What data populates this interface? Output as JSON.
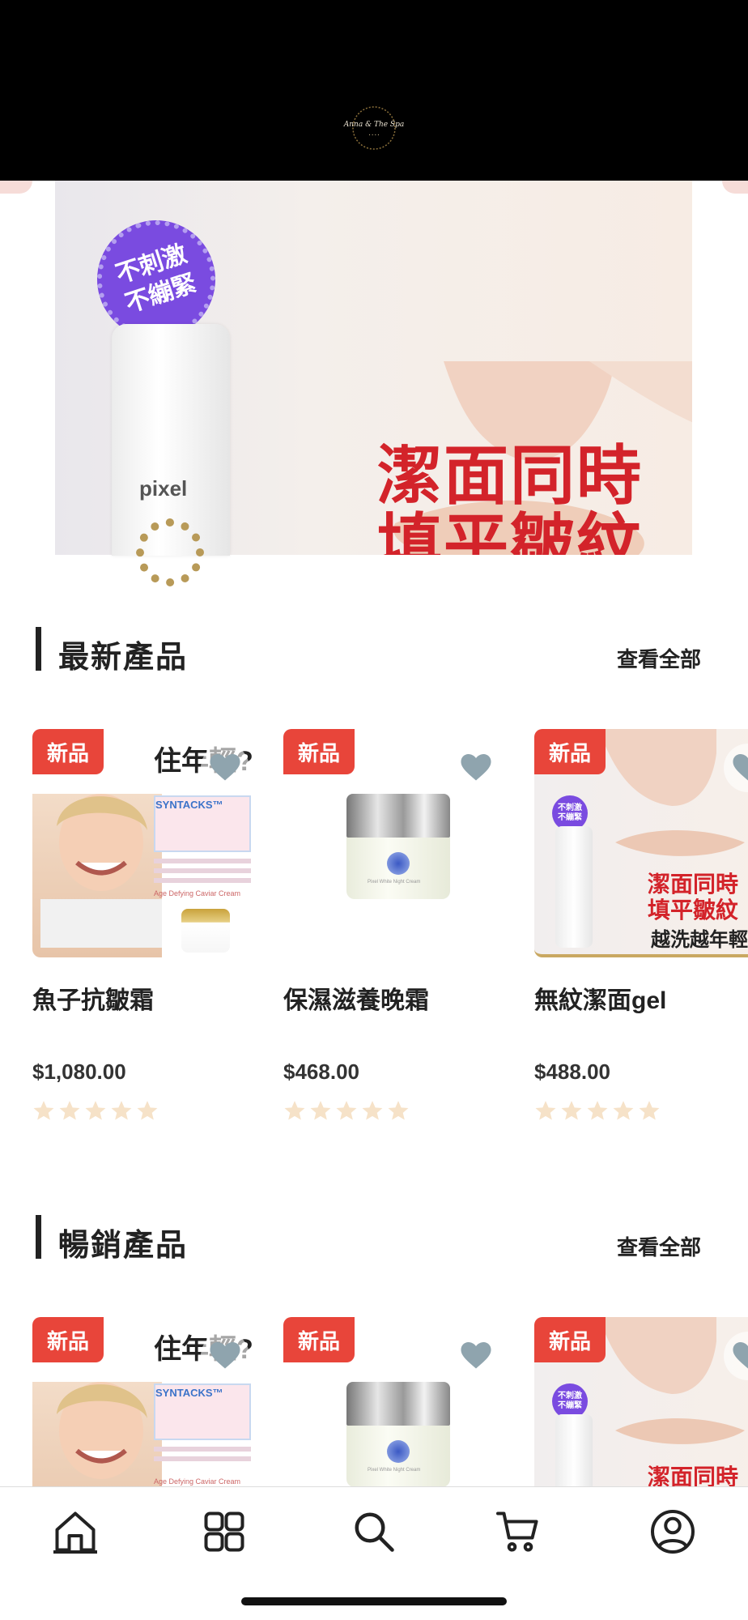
{
  "app": {
    "logo_text": "Anna & The Spa"
  },
  "hero": {
    "badge_line1": "不刺激",
    "badge_line2": "不繃緊",
    "bottle_brand": "pixel",
    "headline_line1": "潔面同時",
    "headline_line2": "填平皺紋"
  },
  "sections": [
    {
      "title": "最新產品",
      "view_all": "查看全部",
      "products": [
        {
          "tag": "新品",
          "name": "魚子抗皺霜",
          "price": "$1,080.00",
          "rating": 0
        },
        {
          "tag": "新品",
          "name": "保濕滋養晚霜",
          "price": "$468.00",
          "rating": 0
        },
        {
          "tag": "新品",
          "name": "無紋潔面gel",
          "price": "$488.00",
          "rating": 0
        }
      ]
    },
    {
      "title": "暢銷產品",
      "view_all": "查看全部",
      "products": [
        {
          "tag": "新品"
        },
        {
          "tag": "新品"
        },
        {
          "tag": "新品"
        }
      ]
    }
  ],
  "product_images": {
    "caviar_top": "住年輕?",
    "caviar_sub": "SYNTACKS™",
    "caviar_foot": "Age Defying Caviar Cream",
    "jar_label": "Pixel White Night Cream",
    "gel_text1": "潔面同時",
    "gel_text2": "填平皺紋",
    "gel_text3": "越洗越年輕"
  },
  "tabbar": {
    "items": [
      "home-icon",
      "grid-icon",
      "search-icon",
      "cart-icon",
      "account-icon"
    ]
  },
  "colors": {
    "accent": "#e8453a",
    "header_bg": "#000000",
    "heart": "#8fa4ae",
    "star": "#f6e2c8"
  }
}
